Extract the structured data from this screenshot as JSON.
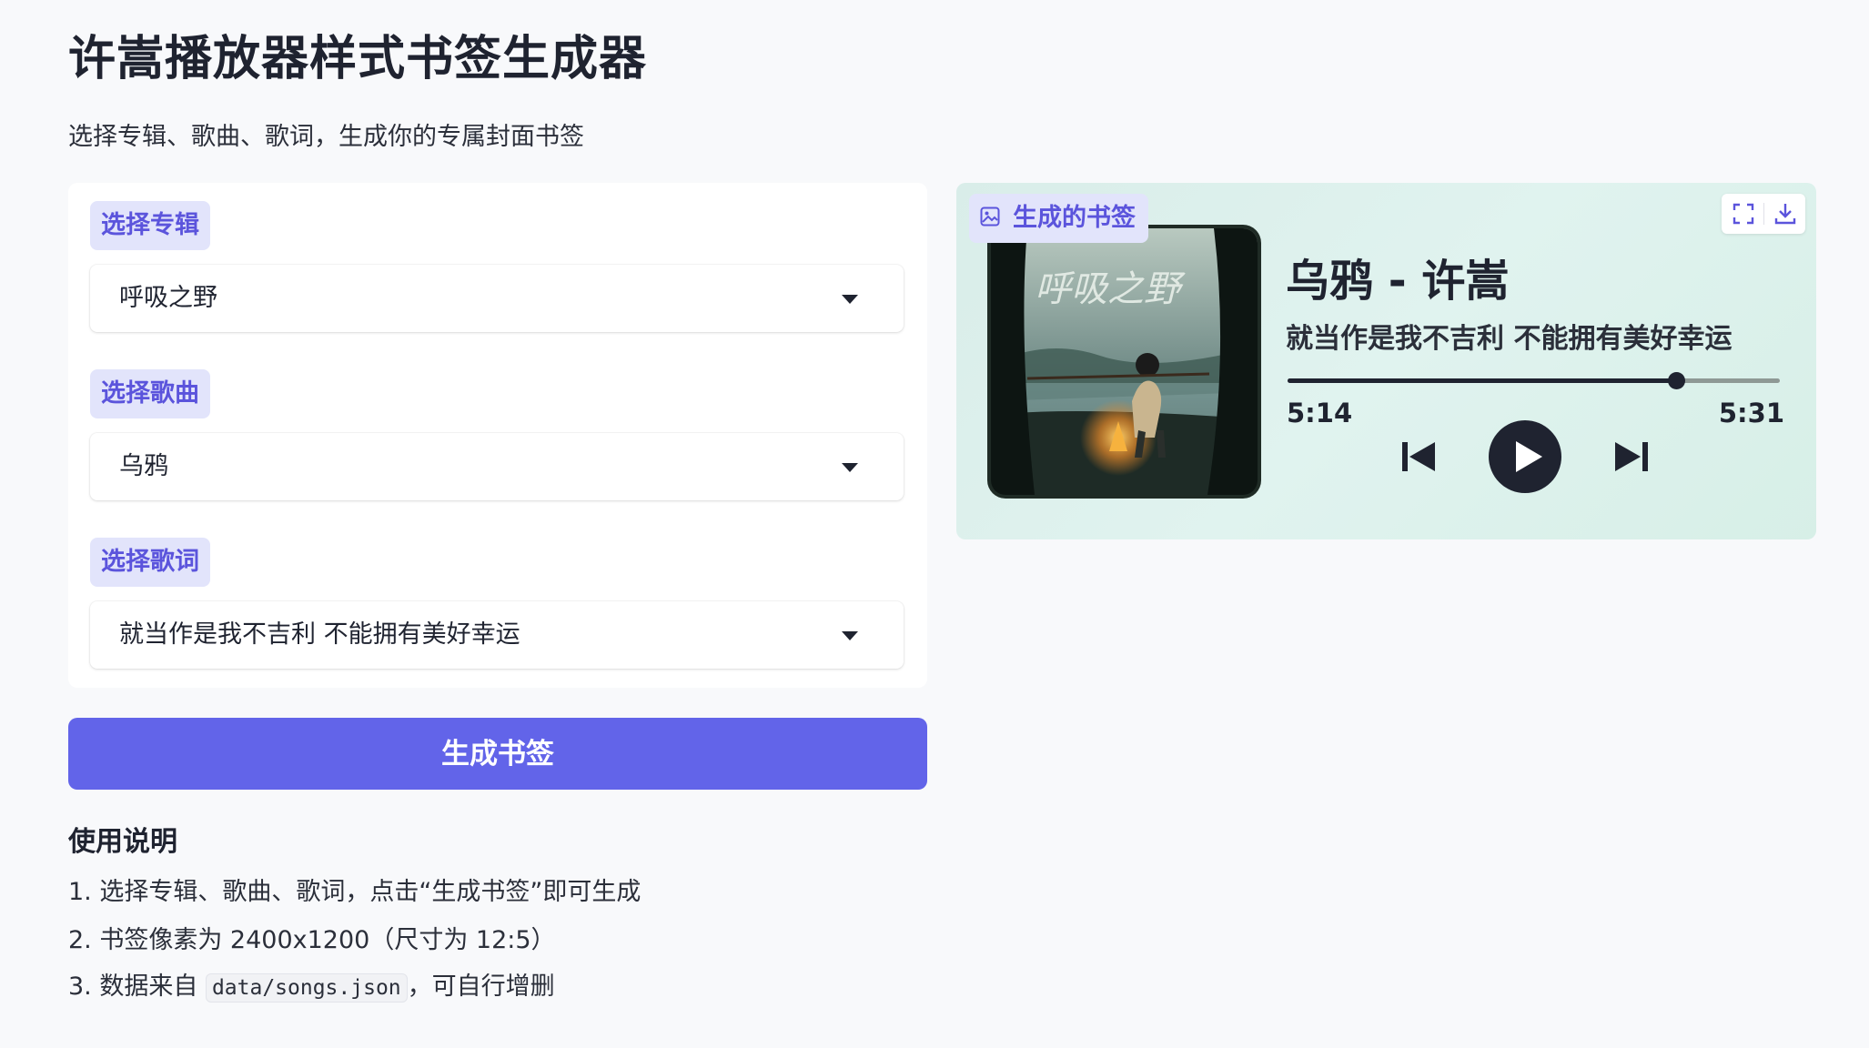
{
  "page": {
    "title": "许嵩播放器样式书签生成器",
    "subtitle": "选择专辑、歌曲、歌词，生成你的专属封面书签"
  },
  "form": {
    "album": {
      "label": "选择专辑",
      "value": "呼吸之野"
    },
    "song": {
      "label": "选择歌曲",
      "value": "乌鸦"
    },
    "lyric": {
      "label": "选择歌词",
      "value": "就当作是我不吉利 不能拥有美好幸运"
    },
    "generate_label": "生成书签"
  },
  "instructions": {
    "title": "使用说明",
    "item1": "1. 选择专辑、歌曲、歌词，点击“生成书签”即可生成",
    "item2": "2. 书签像素为 2400x1200（尺寸为 12:5）",
    "item3_prefix": "3. 数据来自",
    "item3_code": "data/songs.json",
    "item3_suffix": "，可自行增删"
  },
  "preview": {
    "tag_label": "生成的书签",
    "tag_icon": "image-icon",
    "toolbar_icons": [
      "fullscreen-icon",
      "download-icon"
    ],
    "cover_text": "呼吸之野",
    "song_title": "乌鸦 - 许嵩",
    "lyric": "就当作是我不吉利 不能拥有美好幸运",
    "elapsed": "5:14",
    "total": "5:31",
    "progress": 0.79,
    "controls": [
      "previous-icon",
      "play-icon",
      "next-icon"
    ]
  },
  "colors": {
    "accent": "#6264e9",
    "label_bg": "#e2e4fb",
    "label_text": "#5b54dc",
    "preview_bg": "#dff1ec"
  }
}
